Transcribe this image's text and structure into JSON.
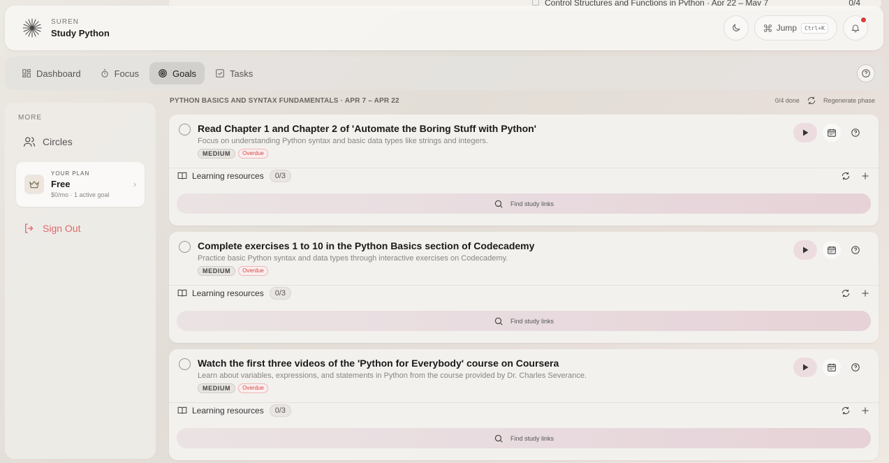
{
  "background_peek": {
    "text": "Control Structures and Functions in Python · Apr 22 – May 7",
    "count": "0/4"
  },
  "topbar": {
    "user": "SUREN",
    "title": "Study Python",
    "jump_label": "Jump",
    "jump_shortcut": "Ctrl+K"
  },
  "nav": {
    "items": [
      {
        "label": "Dashboard",
        "icon": "dashboard-grid-icon"
      },
      {
        "label": "Focus",
        "icon": "timer-icon"
      },
      {
        "label": "Goals",
        "icon": "target-icon"
      },
      {
        "label": "Tasks",
        "icon": "checkbox-icon"
      }
    ],
    "active": "Goals"
  },
  "sidebar": {
    "section_label": "MORE",
    "circles_label": "Circles",
    "plan": {
      "small_label": "YOUR PLAN",
      "name": "Free",
      "meta": "$0/mo · 1 active goal"
    },
    "signout_label": "Sign Out"
  },
  "phase": {
    "title": "Python Basics and Syntax Fundamentals · Apr 7 – Apr 22",
    "done": "0/4 done",
    "regenerate_label": "Regenerate phase"
  },
  "tasks": [
    {
      "title": "Read Chapter 1 and Chapter 2 of 'Automate the Boring Stuff with Python'",
      "description": "Focus on understanding Python syntax and basic data types like strings and integers.",
      "priority": "MEDIUM",
      "status": "Overdue",
      "resources_label": "Learning resources",
      "resources_count": "0/3",
      "find_label": "Find study links"
    },
    {
      "title": "Complete exercises 1 to 10 in the Python Basics section of Codecademy",
      "description": "Practice basic Python syntax and data types through interactive exercises on Codecademy.",
      "priority": "MEDIUM",
      "status": "Overdue",
      "resources_label": "Learning resources",
      "resources_count": "0/3",
      "find_label": "Find study links"
    },
    {
      "title": "Watch the first three videos of the 'Python for Everybody' course on Coursera",
      "description": "Learn about variables, expressions, and statements in Python from the course provided by Dr. Charles Severance.",
      "priority": "MEDIUM",
      "status": "Overdue",
      "resources_label": "Learning resources",
      "resources_count": "0/3",
      "find_label": "Find study links"
    }
  ],
  "colors": {
    "accent_danger": "#d84545",
    "signout": "#e0686a",
    "play_bg": "#ecdcdf"
  }
}
